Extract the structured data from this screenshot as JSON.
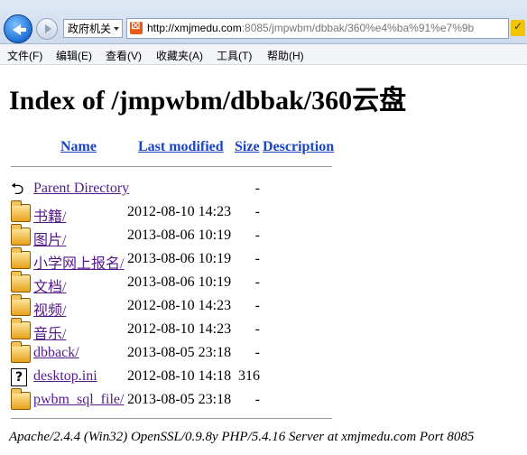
{
  "browser": {
    "favorites_dropdown": "政府机关",
    "url_host": "http://xmjmedu.com",
    "url_rest": ":8085/jmpwbm/dbbak/360%e4%ba%91%e7%9b"
  },
  "menu": [
    "文件(F)",
    "编辑(E)",
    "查看(V)",
    "收藏夹(A)",
    "工具(T)",
    "帮助(H)"
  ],
  "page": {
    "title": "Index of /jmpwbm/dbbak/360云盘",
    "columns": {
      "name": "Name",
      "modified": "Last modified",
      "size": "Size",
      "description": "Description"
    },
    "parent": {
      "name": "Parent Directory",
      "size": "-"
    },
    "rows": [
      {
        "icon": "folder-icon",
        "name": "书籍/",
        "date": "2012-08-10 14:23",
        "size": "-"
      },
      {
        "icon": "folder-icon",
        "name": "图片/",
        "date": "2013-08-06 10:19",
        "size": "-"
      },
      {
        "icon": "folder-icon",
        "name": "小学网上报名/",
        "date": "2013-08-06 10:19",
        "size": "-"
      },
      {
        "icon": "folder-icon",
        "name": "文档/",
        "date": "2013-08-06 10:19",
        "size": "-"
      },
      {
        "icon": "folder-icon",
        "name": "视频/",
        "date": "2012-08-10 14:23",
        "size": "-"
      },
      {
        "icon": "folder-icon",
        "name": "音乐/",
        "date": "2012-08-10 14:23",
        "size": "-"
      },
      {
        "icon": "folder-icon",
        "name": "dbback/",
        "date": "2013-08-05 23:18",
        "size": "-"
      },
      {
        "icon": "unknown-file-icon",
        "name": "desktop.ini",
        "date": "2012-08-10 14:18",
        "size": "316"
      },
      {
        "icon": "folder-icon",
        "name": "pwbm_sql_file/",
        "date": "2013-08-05 23:18",
        "size": "-"
      }
    ],
    "footer": "Apache/2.4.4 (Win32) OpenSSL/0.9.8y PHP/5.4.16 Server at xmjmedu.com Port 8085"
  }
}
